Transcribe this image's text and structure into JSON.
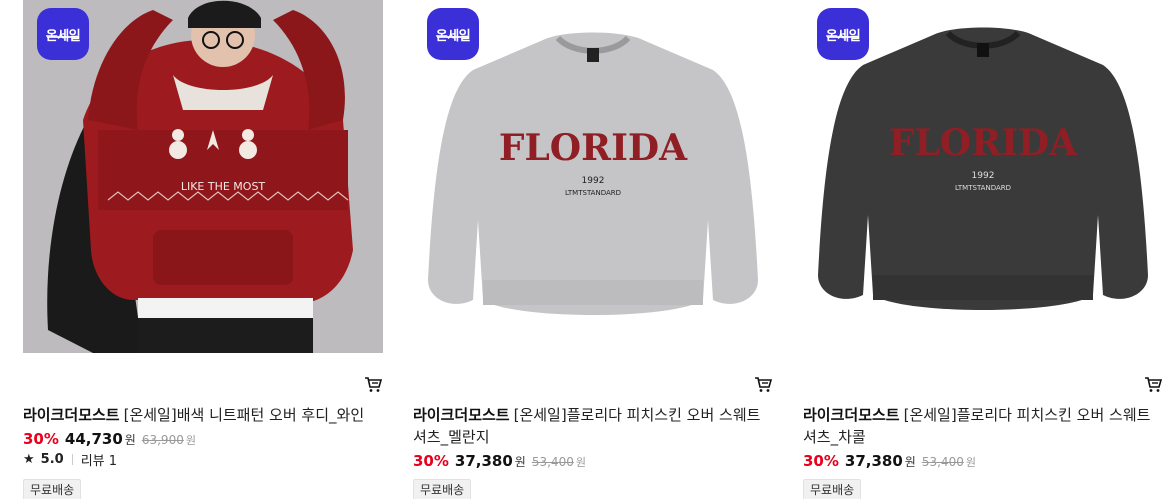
{
  "icons": {
    "cart": "cart-icon",
    "star": "star-icon"
  },
  "colors": {
    "discount": "#e8001c",
    "badge": "#3b2fd8"
  },
  "products": [
    {
      "badge": "온세일",
      "brand": "라이크더모스트",
      "name": "[온세일]배색 니트패턴 오버 후디_와인",
      "discount": "30%",
      "price": "44,730",
      "won": "원",
      "original_price": "63,900",
      "rating": "5.0",
      "reviews": "리뷰 1",
      "shipping": "무료배송"
    },
    {
      "badge": "온세일",
      "brand": "라이크더모스트",
      "name": "[온세일]플로리다 피치스킨 오버 스웨트 셔츠_멜란지",
      "discount": "30%",
      "price": "37,380",
      "won": "원",
      "original_price": "53,400",
      "shipping": "무료배송"
    },
    {
      "badge": "온세일",
      "brand": "라이크더모스트",
      "name": "[온세일]플로리다 피치스킨 오버 스웨트 셔츠_차콜",
      "discount": "30%",
      "price": "37,380",
      "won": "원",
      "original_price": "53,400",
      "shipping": "무료배송"
    }
  ],
  "graphics": {
    "print_top": "FLORIDA",
    "print_year": "1992",
    "print_sub": "LTMTSTANDARD",
    "sweater_text": "LIKE THE MOST"
  }
}
